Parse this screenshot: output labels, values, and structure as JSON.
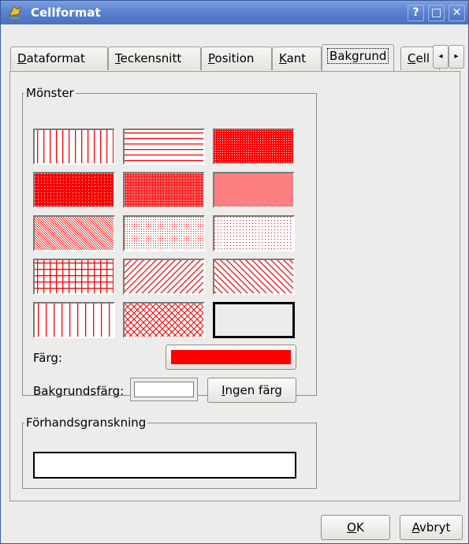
{
  "window": {
    "title": "Cellformat",
    "help_label": "?",
    "maximize_label": "□",
    "close_label": "✕"
  },
  "tabs": [
    {
      "label_u": "D",
      "label_rest": "ataformat"
    },
    {
      "label_u": "T",
      "label_rest": "eckensnitt"
    },
    {
      "label_u": "P",
      "label_rest": "osition"
    },
    {
      "label_u": "K",
      "label_rest": "ant"
    },
    {
      "label_u": "",
      "label_rest": "Bakgrund"
    },
    {
      "label_u": "C",
      "label_rest": "ell"
    }
  ],
  "tab_scroll": {
    "left": "◂",
    "right": "▸"
  },
  "pattern_group": {
    "title": "Mönster",
    "patterns": [
      "vertical-lines",
      "horizontal-lines",
      "dense-dots",
      "solid-fine-dots",
      "fine-crosshatch-dots",
      "medium-dots",
      "medium-light-dots",
      "light-dots",
      "sparse-dots",
      "grid",
      "diagonal-up",
      "diagonal-down",
      "vertical-lines-wide",
      "diagonal-crosshatch",
      "none"
    ],
    "selected_pattern": "none",
    "color_label": "Färg:",
    "color_value": "#ff0000",
    "bg_color_label": "Bakgrundsfärg:",
    "bg_color_value": "#ffffff",
    "no_color_button_u": "I",
    "no_color_button_rest": "ngen färg"
  },
  "preview_group": {
    "title": "Förhandsgranskning"
  },
  "footer": {
    "ok_u": "O",
    "ok_rest": "K",
    "cancel_u": "A",
    "cancel_rest": "vbryt"
  },
  "colors": {
    "pattern_red": "#ff0000",
    "titlebar_blue": "#5a82cf"
  }
}
